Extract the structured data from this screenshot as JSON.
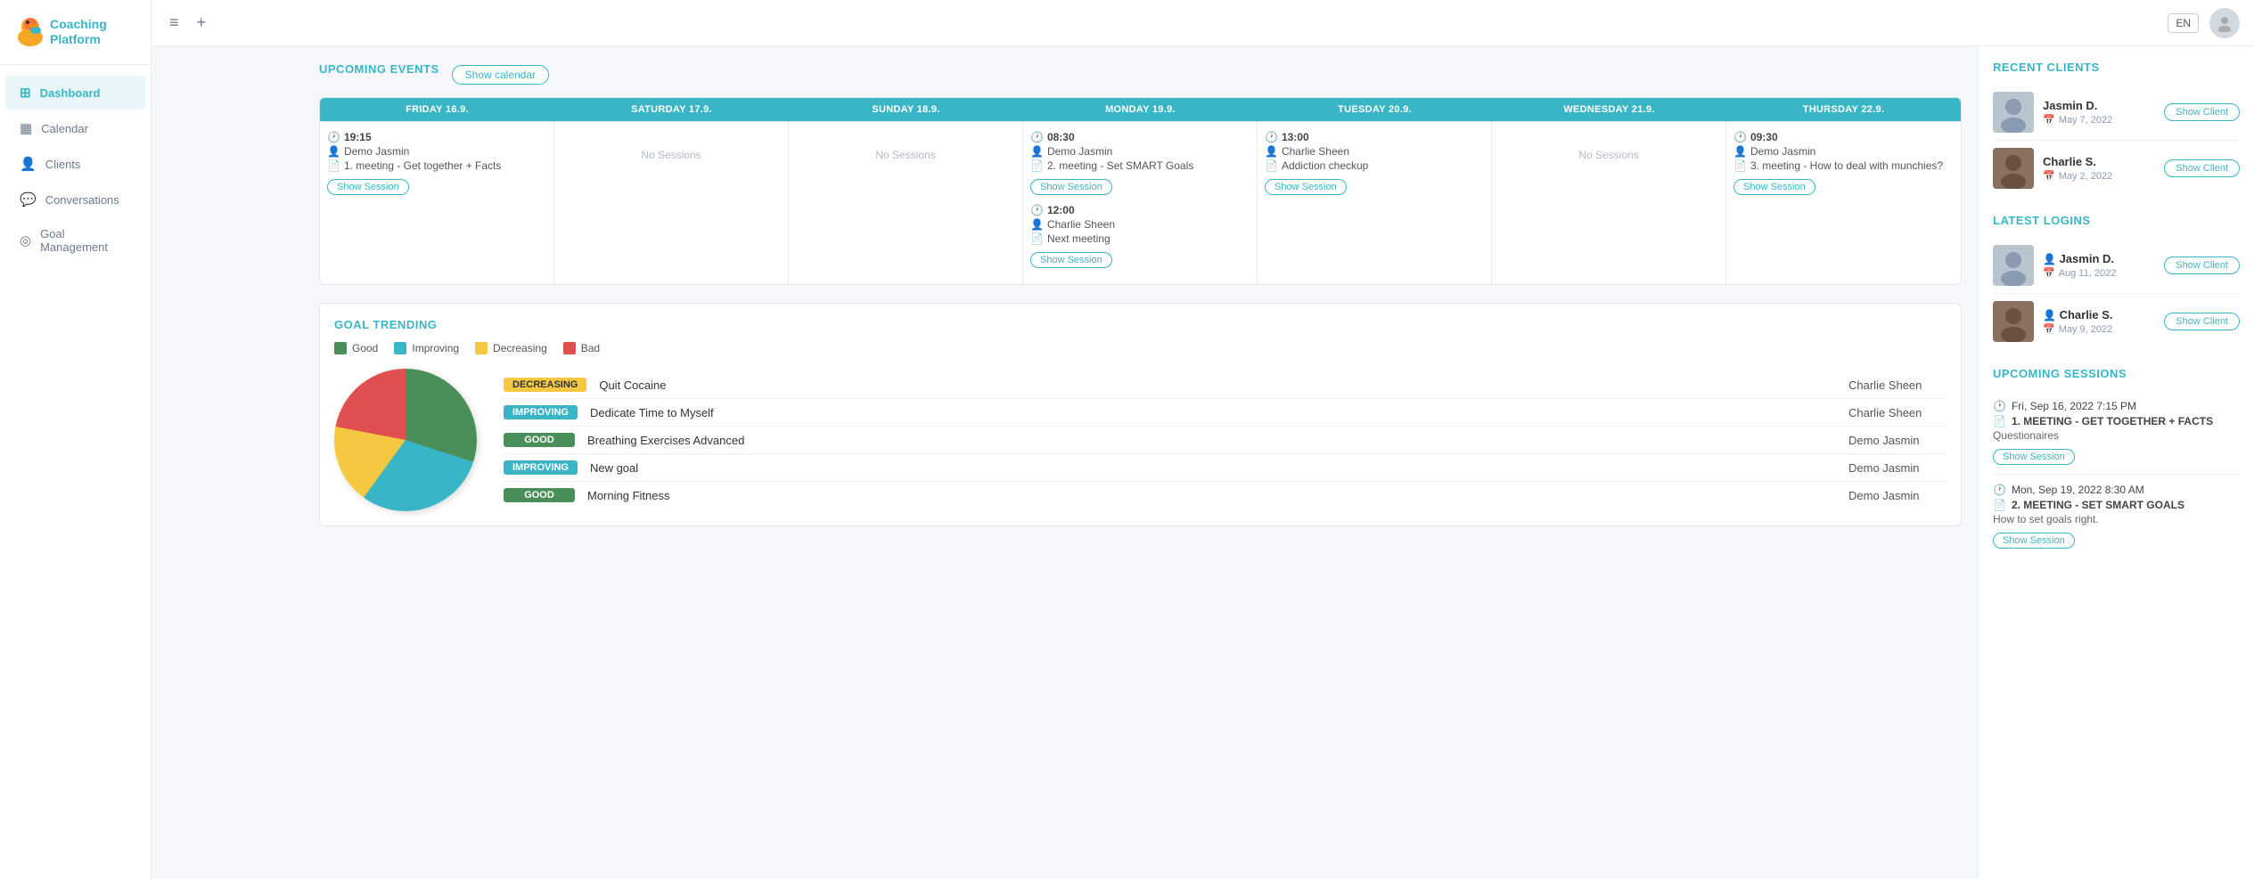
{
  "sidebar": {
    "logo_text": "Coaching\nPlatform",
    "items": [
      {
        "id": "dashboard",
        "label": "Dashboard",
        "icon": "⊞",
        "active": true
      },
      {
        "id": "calendar",
        "label": "Calendar",
        "icon": "▦"
      },
      {
        "id": "clients",
        "label": "Clients",
        "icon": "👤"
      },
      {
        "id": "conversations",
        "label": "Conversations",
        "icon": "💬"
      },
      {
        "id": "goal-management",
        "label": "Goal Management",
        "icon": "◎"
      }
    ]
  },
  "topbar": {
    "lang": "EN",
    "menu_icon": "≡",
    "add_icon": "+"
  },
  "upcoming_events": {
    "title": "UPCOMING EVENTS",
    "show_calendar_label": "Show calendar",
    "days": [
      {
        "label": "FRIDAY 16.9.",
        "events": [
          {
            "time": "19:15",
            "person": "Demo Jasmin",
            "session": "1. meeting - Get together\n+ Facts",
            "show_session_label": "Show Session"
          }
        ]
      },
      {
        "label": "SATURDAY 17.9.",
        "no_sessions": "No Sessions",
        "events": []
      },
      {
        "label": "SUNDAY 18.9.",
        "no_sessions": "No Sessions",
        "events": []
      },
      {
        "label": "MONDAY 19.9.",
        "events": [
          {
            "time": "08:30",
            "person": "Demo Jasmin",
            "session": "2. meeting - Set SMART Goals",
            "show_session_label": "Show Session"
          },
          {
            "time": "12:00",
            "person": "Charlie Sheen",
            "session": "Next meeting",
            "show_session_label": "Show Session"
          }
        ]
      },
      {
        "label": "TUESDAY 20.9.",
        "events": [
          {
            "time": "13:00",
            "person": "Charlie Sheen",
            "session": "Addiction checkup",
            "show_session_label": "Show Session"
          }
        ]
      },
      {
        "label": "WEDNESDAY 21.9.",
        "no_sessions": "No Sessions",
        "events": []
      },
      {
        "label": "THURSDAY 22.9.",
        "events": [
          {
            "time": "09:30",
            "person": "Demo Jasmin",
            "session": "3. meeting - How to deal with munchies?",
            "show_session_label": "Show Session"
          }
        ]
      }
    ]
  },
  "goal_trending": {
    "title": "GOAL TRENDING",
    "legend": [
      {
        "label": "Good",
        "color": "#4a8f5a"
      },
      {
        "label": "Improving",
        "color": "#3ab5c6"
      },
      {
        "label": "Decreasing",
        "color": "#f5c842"
      },
      {
        "label": "Bad",
        "color": "#e05050"
      }
    ],
    "pie_segments": [
      {
        "label": "Good",
        "color": "#4a8f5a",
        "percent": 30
      },
      {
        "label": "Improving",
        "color": "#3ab5c6",
        "percent": 30
      },
      {
        "label": "Decreasing",
        "color": "#f5c842",
        "percent": 18
      },
      {
        "label": "Bad",
        "color": "#e05050",
        "percent": 22
      }
    ],
    "goals": [
      {
        "badge": "DECREASING",
        "badge_type": "decreasing",
        "name": "Quit Cocaine",
        "client": "Charlie Sheen"
      },
      {
        "badge": "IMPROVING",
        "badge_type": "improving",
        "name": "Dedicate Time to Myself",
        "client": "Charlie Sheen"
      },
      {
        "badge": "GOOD",
        "badge_type": "good",
        "name": "Breathing Exercises Advanced",
        "client": "Demo Jasmin"
      },
      {
        "badge": "IMPROVING",
        "badge_type": "improving",
        "name": "New goal",
        "client": "Demo Jasmin"
      },
      {
        "badge": "GOOD",
        "badge_type": "good",
        "name": "Morning Fitness",
        "client": "Demo Jasmin"
      }
    ]
  },
  "recent_clients": {
    "title": "RECENT CLIENTS",
    "clients": [
      {
        "name": "Jasmin D.",
        "date": "May 7, 2022",
        "show_label": "Show Client"
      },
      {
        "name": "Charlie S.",
        "date": "May 2, 2022",
        "show_label": "Show Client"
      }
    ]
  },
  "latest_logins": {
    "title": "LATEST LOGINS",
    "clients": [
      {
        "name": "Jasmin D.",
        "date": "Aug 11, 2022",
        "show_label": "Show Client"
      },
      {
        "name": "Charlie S.",
        "date": "May 9, 2022",
        "show_label": "Show Client"
      }
    ]
  },
  "upcoming_sessions": {
    "title": "UPCOMING SESSIONS",
    "sessions": [
      {
        "time": "Fri, Sep 16, 2022 7:15 PM",
        "name": "1. MEETING - GET TOGETHER + FACTS",
        "desc": "Questionaires",
        "show_label": "Show Session"
      },
      {
        "time": "Mon, Sep 19, 2022 8:30 AM",
        "name": "2. MEETING - SET SMART GOALS",
        "desc": "How to set goals right.",
        "show_label": "Show Session"
      }
    ]
  }
}
